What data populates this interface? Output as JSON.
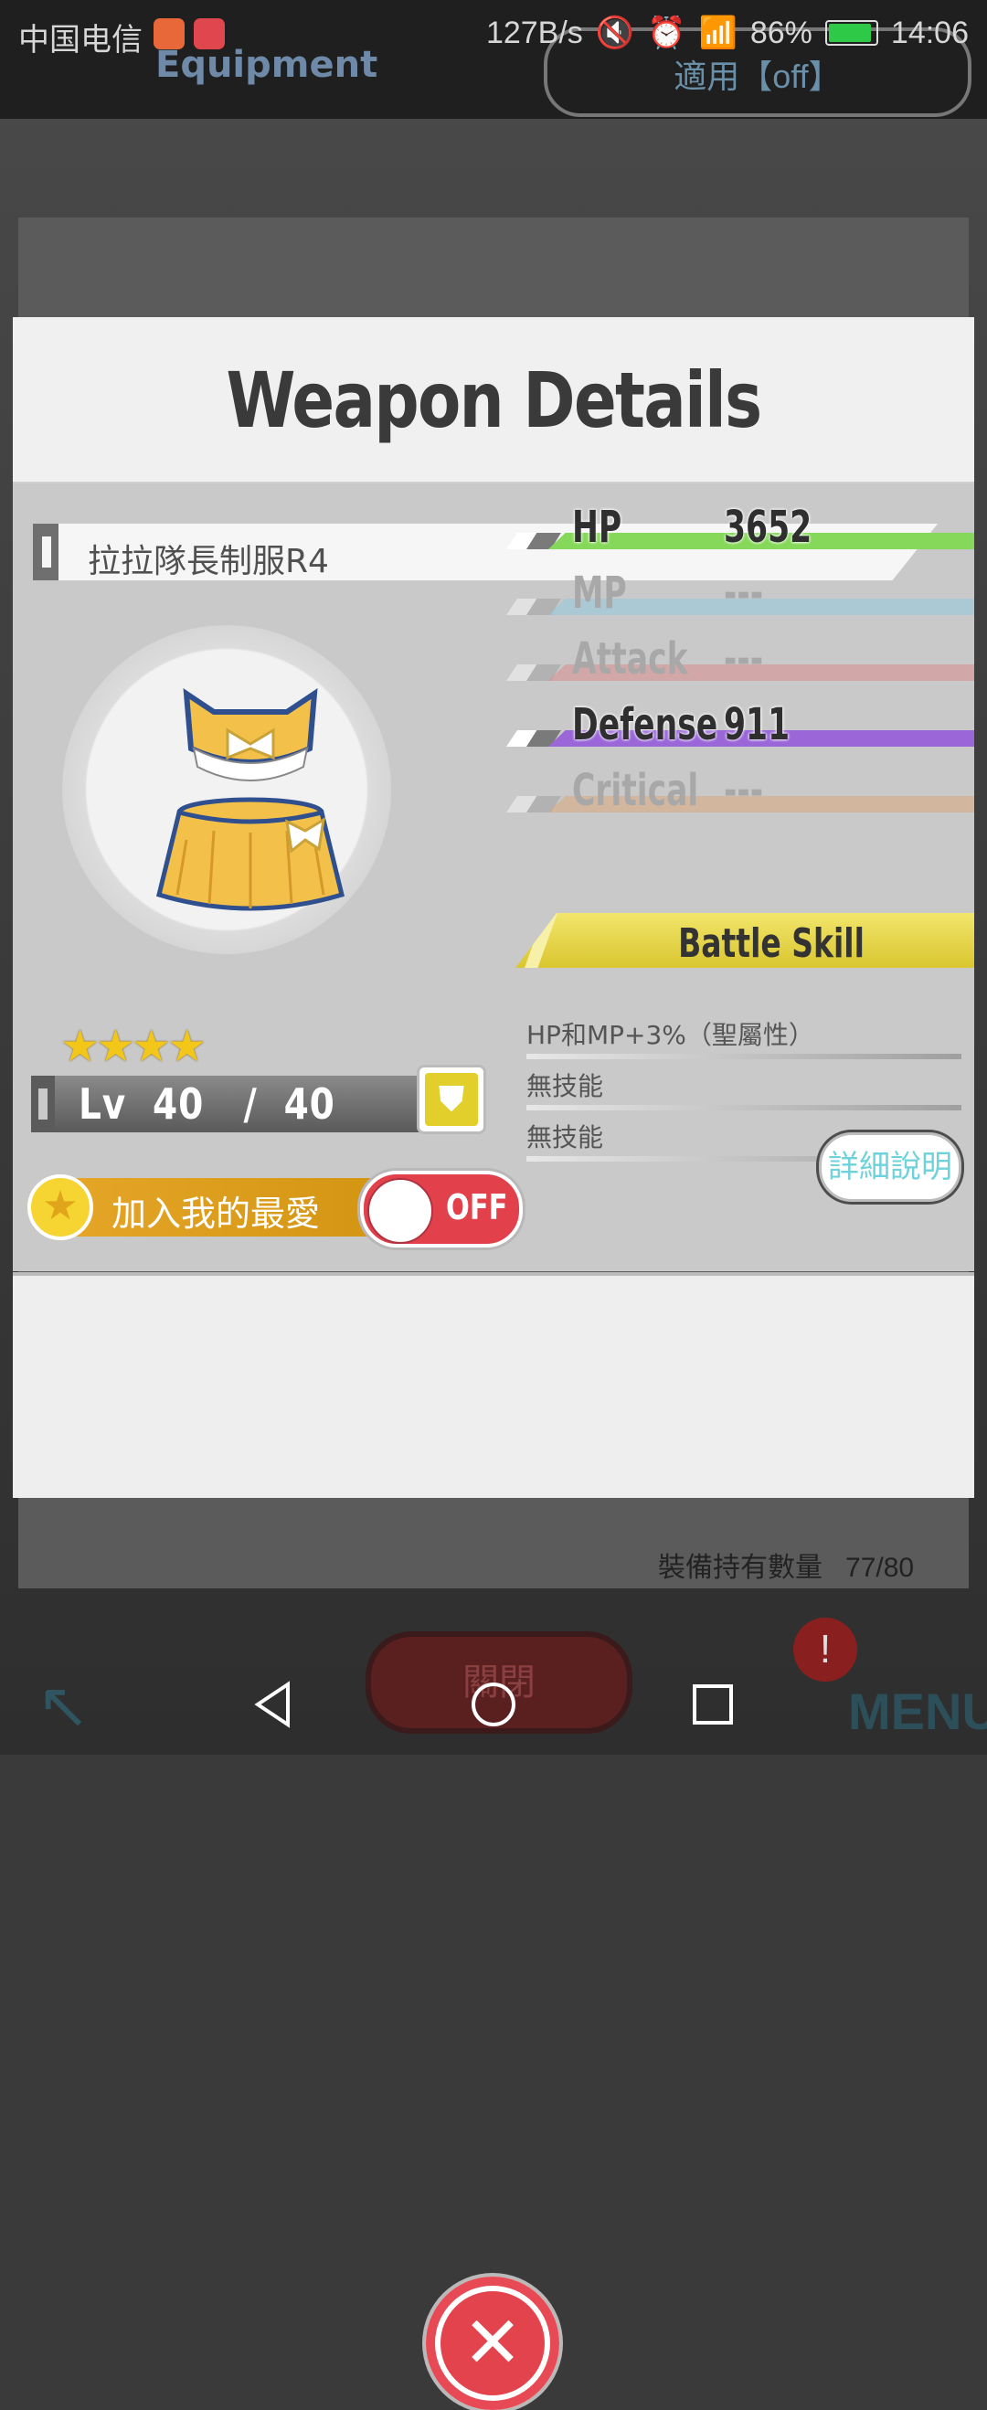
{
  "status_bar": {
    "carrier": "中国电信",
    "net_speed": "127B/s",
    "battery": "86%",
    "time": "14:06"
  },
  "background": {
    "screen_title": "Equipment",
    "toggle_label": "適用【off】",
    "count_label": "裝備持有數量",
    "count_value": "77/80",
    "close_label": "關閉",
    "alert": "!",
    "menu_label": "MENU"
  },
  "modal": {
    "title": "Weapon Details",
    "item_name": "拉拉隊長制服R4",
    "rarity_stars": 4,
    "level": {
      "prefix": "Lv",
      "current": "40",
      "separator": "/",
      "max": "40"
    },
    "favorite": {
      "label": "加入我的最愛",
      "state": "OFF"
    },
    "stats": [
      {
        "label": "HP",
        "value": "3652",
        "active": true,
        "color": "#86d85a"
      },
      {
        "label": "MP",
        "value": "---",
        "active": false,
        "color": "#8fc9dc"
      },
      {
        "label": "Attack",
        "value": "---",
        "active": false,
        "color": "#d98a8a"
      },
      {
        "label": "Defense",
        "value": "911",
        "active": true,
        "color": "#9a66d8"
      },
      {
        "label": "Critical",
        "value": "---",
        "active": false,
        "color": "#d9a77a"
      }
    ],
    "battle_skill": {
      "title": "Battle Skill",
      "lines": [
        "HP和MP+3%（聖屬性）",
        "無技能",
        "無技能"
      ]
    },
    "detail_button": "詳細說明",
    "close_icon": "close-icon"
  },
  "nav": {
    "back": "back-icon",
    "home": "home-icon",
    "recents": "recents-icon"
  }
}
